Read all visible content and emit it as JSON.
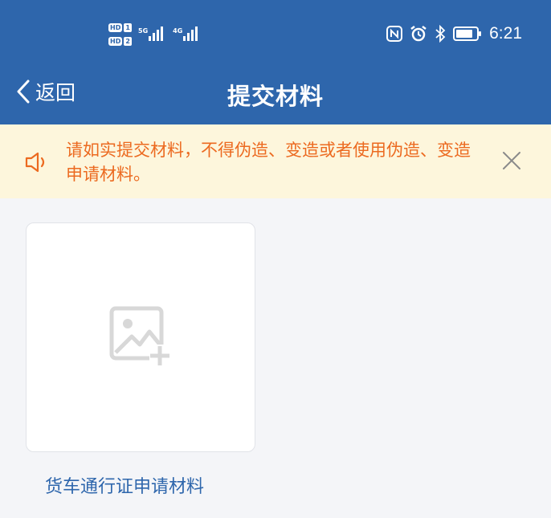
{
  "status_bar": {
    "sim1_badge": "HD",
    "sim1_num": "1",
    "sim2_badge": "HD",
    "sim2_num": "2",
    "signal1_label": "5G",
    "signal2_label": "4G",
    "time": "6:21",
    "icons": [
      "nfc-icon",
      "alarm-icon",
      "bluetooth-icon",
      "battery-icon"
    ]
  },
  "nav": {
    "back_label": "返回",
    "title": "提交材料"
  },
  "notice": {
    "text": "请如实提交材料，不得伪造、变造或者使用伪造、变造申请材料。",
    "icon": "speaker-icon",
    "close_icon": "close-icon"
  },
  "upload": {
    "icon": "add-image-icon",
    "label": "货车通行证申请材料"
  },
  "colors": {
    "header": "#2e66ac",
    "notice_bg": "#fdf6dc",
    "notice_text": "#ec6a20",
    "page_bg": "#f4f5f8",
    "label": "#2e66ac"
  }
}
